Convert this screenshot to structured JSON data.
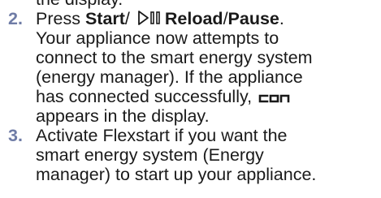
{
  "instructions": {
    "cut_line": "the display.",
    "steps": [
      {
        "number": "2.",
        "action_prefix": "Press ",
        "start_label": "Start",
        "slash1": "/ ",
        "reload_label": "Reload",
        "slash2": "/",
        "pause_label": "Pause",
        "end_period": ".",
        "lines": [
          "Your appliance now attempts to",
          "connect to the smart energy system",
          "(energy manager). If the appliance"
        ],
        "line_with_code_prefix": "has connected successfully, ",
        "display_code": "con",
        "last_line": "appears in the display."
      },
      {
        "number": "3.",
        "lines": [
          "Activate Flexstart if you want the",
          "smart energy system (Energy",
          "manager) to start up your appliance."
        ]
      }
    ],
    "icons": [
      "play-pause-icon",
      "seven-segment-con-icon"
    ]
  }
}
